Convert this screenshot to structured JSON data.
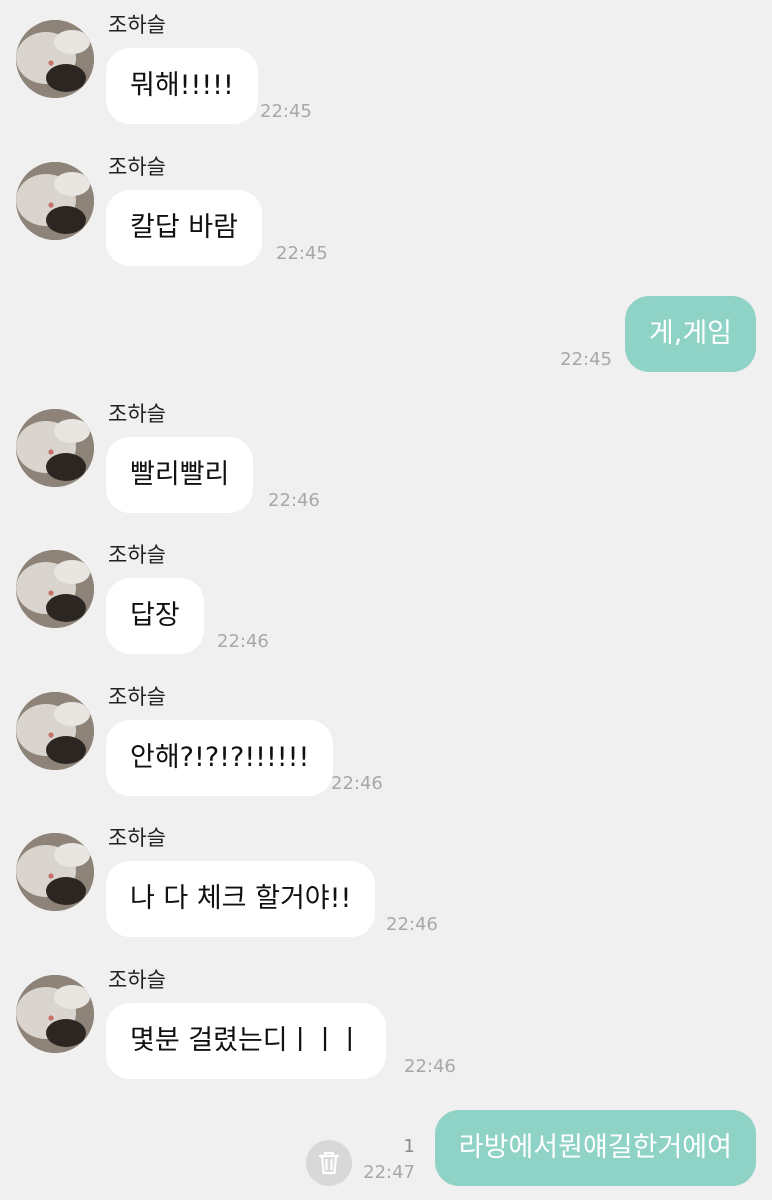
{
  "sender_name": "조하슬",
  "colors": {
    "background": "#f0f0f0",
    "incoming_bubble": "#ffffff",
    "outgoing_bubble": "#8fd3c6",
    "timestamp": "#a8a8a8"
  },
  "messages": [
    {
      "direction": "in",
      "sender": "조하슬",
      "text": "뭐해!!!!!",
      "time": "22:45"
    },
    {
      "direction": "in",
      "sender": "조하슬",
      "text": "칼답 바람",
      "time": "22:45"
    },
    {
      "direction": "out",
      "text": "게,게임",
      "time": "22:45"
    },
    {
      "direction": "in",
      "sender": "조하슬",
      "text": "빨리빨리",
      "time": "22:46"
    },
    {
      "direction": "in",
      "sender": "조하슬",
      "text": "답장",
      "time": "22:46"
    },
    {
      "direction": "in",
      "sender": "조하슬",
      "text": "안해?!?!?!!!!!!",
      "time": "22:46"
    },
    {
      "direction": "in",
      "sender": "조하슬",
      "text": "나 다 체크 할거야!!",
      "time": "22:46"
    },
    {
      "direction": "in",
      "sender": "조하슬",
      "text": "몇분 걸렸는디ㅣㅣㅣ",
      "time": "22:46"
    },
    {
      "direction": "out",
      "text": "라방에서뭔얘길한거에여",
      "time": "22:47",
      "unread_count": "1",
      "action_icon": "trash-icon"
    }
  ]
}
